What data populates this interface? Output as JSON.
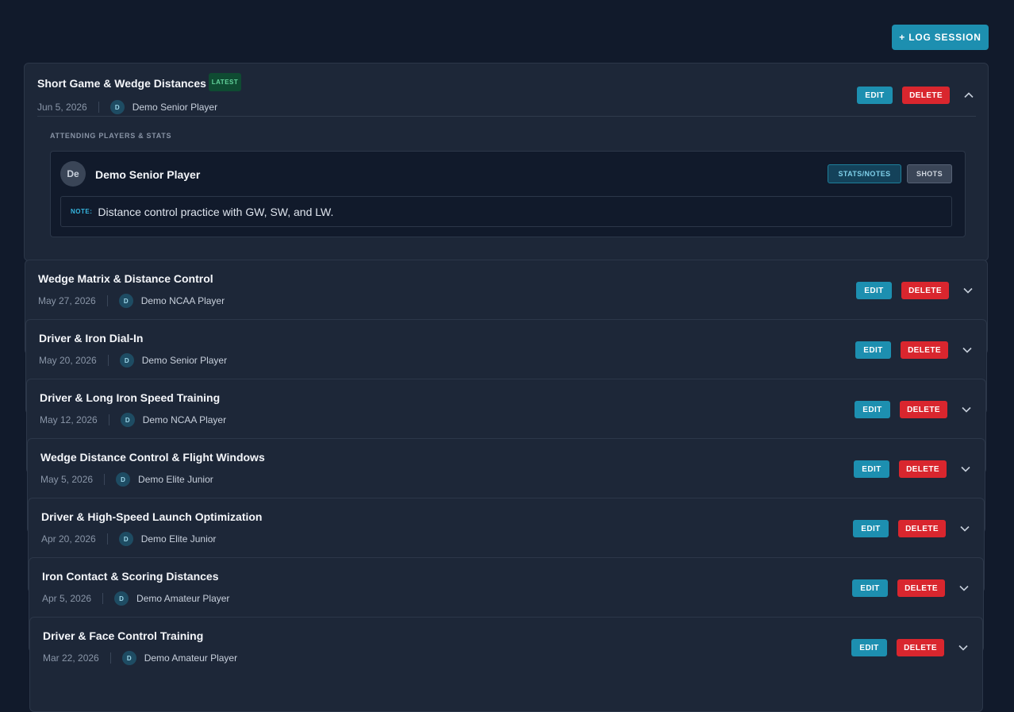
{
  "toolbar": {
    "log_session_label": "+ LOG SESSION"
  },
  "labels": {
    "edit": "EDIT",
    "delete": "DELETE",
    "latest": "LATEST",
    "attending": "ATTENDING PLAYERS & STATS",
    "stats_notes": "STATS/NOTES",
    "shots": "SHOTS",
    "note": "NOTE:"
  },
  "expanded": {
    "title": "Short Game & Wedge Distances",
    "date": "Jun 5, 2026",
    "avatar": "D",
    "player": "Demo Senior Player",
    "attendee": {
      "initials": "De",
      "name": "Demo Senior Player",
      "note": "Distance control practice with GW, SW, and LW."
    }
  },
  "sessions": [
    {
      "title": "Wedge Matrix & Distance Control",
      "date": "May 27, 2026",
      "avatar": "D",
      "player": "Demo NCAA Player"
    },
    {
      "title": "Driver & Iron Dial-In",
      "date": "May 20, 2026",
      "avatar": "D",
      "player": "Demo Senior Player"
    },
    {
      "title": "Driver & Long Iron Speed Training",
      "date": "May 12, 2026",
      "avatar": "D",
      "player": "Demo NCAA Player"
    },
    {
      "title": "Wedge Distance Control & Flight Windows",
      "date": "May 5, 2026",
      "avatar": "D",
      "player": "Demo Elite Junior"
    },
    {
      "title": "Driver & High-Speed Launch Optimization",
      "date": "Apr 20, 2026",
      "avatar": "D",
      "player": "Demo Elite Junior"
    },
    {
      "title": "Iron Contact & Scoring Distances",
      "date": "Apr 5, 2026",
      "avatar": "D",
      "player": "Demo Amateur Player"
    },
    {
      "title": "Driver & Face Control Training",
      "date": "Mar 22, 2026",
      "avatar": "D",
      "player": "Demo Amateur Player"
    }
  ],
  "colors": {
    "background": "#111a2b",
    "card": "#1d2738",
    "accent": "#1d8fb0",
    "danger": "#d9262e",
    "latest_badge": "#0f4b32"
  }
}
